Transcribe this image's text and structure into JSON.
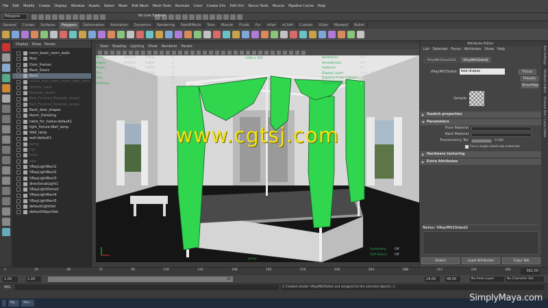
{
  "menu": [
    "File",
    "Edit",
    "Modify",
    "Create",
    "Display",
    "Window",
    "Assets",
    "Select",
    "Mesh",
    "Edit Mesh",
    "Mesh Tools",
    "Normals",
    "Color",
    "Create UVs",
    "Edit UVs",
    "Bonus Tools",
    "Muscle",
    "Pipeline Cache",
    "Help"
  ],
  "mode_select": "Polygons",
  "status": {
    "no_live": "No Live Surface"
  },
  "shelf_tabs": [
    "General",
    "Curves",
    "Surfaces",
    "Polygons",
    "Deformation",
    "Animation",
    "Dynamics",
    "Rendering",
    "PaintEffects",
    "Toon",
    "Muscle",
    "Fluids",
    "Fur",
    "nHair",
    "nCloth",
    "Custom",
    "XGen",
    "Maxwell",
    "Bullet"
  ],
  "shelf_active": "Polygons",
  "outliner": {
    "menu": [
      "Display",
      "Show",
      "Panels"
    ],
    "items": [
      {
        "label": "room_basic_room_walls",
        "state": "normal"
      },
      {
        "label": "floor",
        "state": "normal"
      },
      {
        "label": "Door_frames",
        "state": "normal"
      },
      {
        "label": "Back_Doors",
        "state": "normal"
      },
      {
        "label": "Bed1",
        "state": "sel"
      },
      {
        "label": "couch_with_cloth_couch_with_cloth",
        "state": "dim"
      },
      {
        "label": "Whittle_table",
        "state": "dim"
      },
      {
        "label": "Bedside_table1",
        "state": "dim"
      },
      {
        "label": "Bed_Finished_Bedside_lamp1",
        "state": "dim"
      },
      {
        "label": "Bed_Finished_Bedside_lamp1",
        "state": "dim"
      },
      {
        "label": "Back_door_drapes",
        "state": "normal"
      },
      {
        "label": "Room_Detailing",
        "state": "normal"
      },
      {
        "label": "table_for_hedus:default1",
        "state": "normal"
      },
      {
        "label": "light_fixture:Wall_lamp",
        "state": "normal"
      },
      {
        "label": "Wall_lamp",
        "state": "normal"
      },
      {
        "label": "wall:default1",
        "state": "normal"
      },
      {
        "label": "persp",
        "state": "dim"
      },
      {
        "label": "top",
        "state": "dim"
      },
      {
        "label": "front",
        "state": "dim"
      },
      {
        "label": "side",
        "state": "dim"
      },
      {
        "label": "VRayLightRect1",
        "state": "normal"
      },
      {
        "label": "VRayLightRect2",
        "state": "normal"
      },
      {
        "label": "VRayLightRect3",
        "state": "normal"
      },
      {
        "label": "directionalLight1",
        "state": "normal"
      },
      {
        "label": "VRayLightDome1",
        "state": "normal"
      },
      {
        "label": "VRayLightRect4",
        "state": "normal"
      },
      {
        "label": "VRayLightRect5",
        "state": "normal"
      },
      {
        "label": "defaultLightSet",
        "state": "normal"
      },
      {
        "label": "defaultObjectSet",
        "state": "normal"
      }
    ]
  },
  "viewport": {
    "menu": [
      "View",
      "Shading",
      "Lighting",
      "Show",
      "Renderer",
      "Panels"
    ],
    "hud_left": [
      {
        "k": "Verts:",
        "a": "489433",
        "b": "17532",
        "c": "0"
      },
      {
        "k": "Edges:",
        "a": "942646",
        "b": "34896",
        "c": "0"
      },
      {
        "k": "Faces:",
        "a": "544256",
        "b": "16362",
        "c": "0"
      },
      {
        "k": "Tris:",
        "a": "753879",
        "b": "33782",
        "c": "0"
      },
      {
        "k": "UVs:",
        "a": "609284",
        "b": "17532",
        "c": "0"
      },
      {
        "k": "Particles:",
        "a": "0",
        "b": "0",
        "c": "0"
      }
    ],
    "hud_right": [
      {
        "k": "Backfaces:",
        "v": "ON"
      },
      {
        "k": "Smoothness:",
        "v": "N/A"
      },
      {
        "k": "Instance:",
        "v": "NO"
      },
      {
        "k": "Display Layer:",
        "v": "base_poly"
      },
      {
        "k": "Distance From Camera:",
        "v": "897.501"
      },
      {
        "k": "Selected Objects:",
        "v": "1"
      }
    ],
    "resolution": "1280 x 720",
    "camera": "persp",
    "hud_bottom_right": [
      {
        "k": "Symmetry:",
        "v": "Off"
      },
      {
        "k": "Soft Select:",
        "v": "Off"
      }
    ],
    "watermark": "www.cgtsj.com"
  },
  "attr": {
    "title": "Attribute Editor",
    "menu": [
      "List",
      "Selected",
      "Focus",
      "Attributes",
      "Show",
      "Help"
    ],
    "tabs": [
      "VRayMtl2Sided2SG",
      "VRayMtl2Sided2"
    ],
    "active_tab": "VRayMtl2Sided2",
    "node_label": "VRayMtl2Sided:",
    "node_value": "bed drapes",
    "focus": "Focus",
    "presets": "Presets",
    "show": "Show",
    "hide": "Hide",
    "sample": "Sample",
    "sections": {
      "swatch": "Swatch properties",
      "params": "Parameters",
      "hw": "Hardware texturing",
      "extra": "Extra Attributes"
    },
    "rows": {
      "front": "Front Material",
      "back": "Back Material",
      "trans": "Translucency Tex",
      "trans_val": "0.500",
      "force": "Force single-sided sub-materials"
    },
    "notes": "Notes: VRayMtl2Sided2",
    "buttons": [
      "Select",
      "Load Attributes",
      "Copy Tab"
    ]
  },
  "sidetabs": [
    "Tool Settings",
    "Attribute Editor",
    "Channel Box / Layer Editor"
  ],
  "timeslider": {
    "ticks": [
      "1",
      "24",
      "48",
      "72",
      "96",
      "120",
      "144",
      "168",
      "192",
      "216",
      "240",
      "264",
      "288",
      "312",
      "336",
      "360"
    ],
    "current": "362.00"
  },
  "range": {
    "start": "1.00",
    "start2": "1.00",
    "mid": "24",
    "end": "24.00",
    "end2": "48.00",
    "anim_layer": "No Anim Layer",
    "char_set": "No Character Set"
  },
  "cmd": {
    "label": "MEL",
    "feedback": "// Created shader VRayMtl2Sided and assigned to the selected objects. //"
  },
  "taskbar": [
    "My...",
    "Ren..."
  ],
  "brand": "SimplyMaya.com"
}
